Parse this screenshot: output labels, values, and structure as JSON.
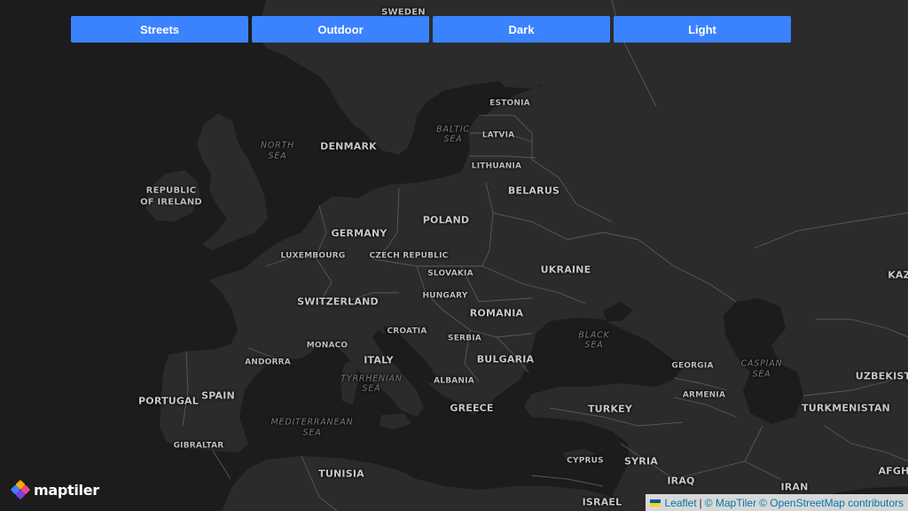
{
  "style_buttons": [
    {
      "label": "Streets"
    },
    {
      "label": "Outdoor"
    },
    {
      "label": "Dark"
    },
    {
      "label": "Light"
    }
  ],
  "labels": {
    "sweden": "SWEDEN",
    "estonia": "ESTONIA",
    "latvia": "LATVIA",
    "lithuania": "LITHUANIA",
    "belarus": "BELARUS",
    "poland": "POLAND",
    "denmark": "DENMARK",
    "ireland_1": "REPUBLIC",
    "ireland_2": "OF IRELAND",
    "germany": "GERMANY",
    "luxembourg": "LUXEMBOURG",
    "czech": "CZECH REPUBLIC",
    "slovakia": "SLOVAKIA",
    "ukraine": "UKRAINE",
    "hungary": "HUNGARY",
    "switzerland": "SWITZERLAND",
    "romania": "ROMANIA",
    "croatia": "CROATIA",
    "serbia": "SERBIA",
    "monaco": "MONACO",
    "italy": "ITALY",
    "andorra": "ANDORRA",
    "bulgaria": "BULGARIA",
    "georgia": "GEORGIA",
    "albania": "ALBANIA",
    "spain": "SPAIN",
    "portugal": "PORTUGAL",
    "armenia": "ARMENIA",
    "greece": "GREECE",
    "turkey": "TURKEY",
    "turkmenistan": "TURKMENISTAN",
    "uzbekistan": "UZBEKIST",
    "kazakhstan": "KAZ",
    "gibraltar": "GIBRALTAR",
    "cyprus": "CYPRUS",
    "syria": "SYRIA",
    "tunisia": "TUNISIA",
    "iraq": "IRAQ",
    "iran": "IRAN",
    "afghanistan": "AFGH",
    "israel": "ISRAEL"
  },
  "seas": {
    "north_1": "NORTH",
    "north_2": "SEA",
    "baltic_1": "BALTIC",
    "baltic_2": "SEA",
    "black_1": "BLACK",
    "black_2": "SEA",
    "caspian_1": "CASPIAN",
    "caspian_2": "SEA",
    "tyrrhenian_1": "TYRRHENIAN",
    "tyrrhenian_2": "SEA",
    "mediterranean_1": "MEDITERRANEAN",
    "mediterranean_2": "SEA"
  },
  "logo": {
    "text": "maptiler",
    "colors": [
      "#ffaa01",
      "#e94a8d",
      "#7b3fe4",
      "#3b82ff"
    ]
  },
  "attribution": {
    "leaflet": "Leaflet",
    "sep": "|",
    "maptiler": "© MapTiler",
    "osm": "© OpenStreetMap contributors"
  },
  "colors": {
    "button": "#3b82ff",
    "land": "#2b2b2b",
    "water": "#1c1c1c",
    "border": "#595959"
  }
}
